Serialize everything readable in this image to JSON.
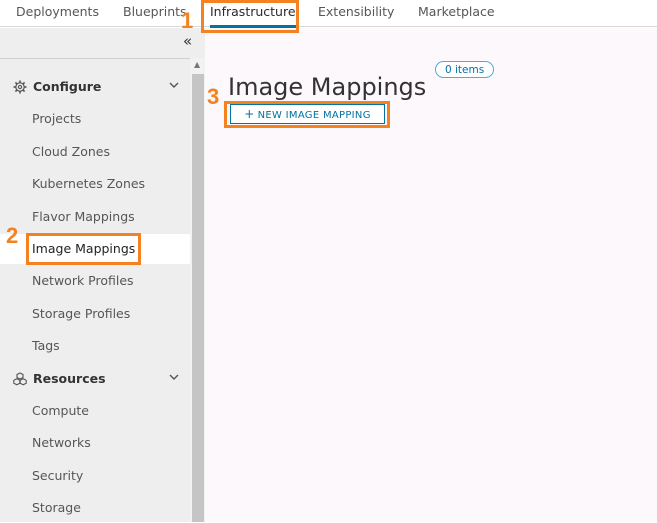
{
  "topnav": {
    "tabs": [
      {
        "label": "Deployments"
      },
      {
        "label": "Blueprints"
      },
      {
        "label": "Infrastructure"
      },
      {
        "label": "Extensibility"
      },
      {
        "label": "Marketplace"
      }
    ],
    "active_tab": "Infrastructure"
  },
  "sidebar": {
    "collapse_icon": "double-chevron-left-icon",
    "groups": [
      {
        "label": "Configure",
        "icon": "gear-icon",
        "expanded": true,
        "items": [
          {
            "label": "Projects"
          },
          {
            "label": "Cloud Zones"
          },
          {
            "label": "Kubernetes Zones"
          },
          {
            "label": "Flavor Mappings"
          },
          {
            "label": "Image Mappings"
          },
          {
            "label": "Network Profiles"
          },
          {
            "label": "Storage Profiles"
          },
          {
            "label": "Tags"
          }
        ]
      },
      {
        "label": "Resources",
        "icon": "cubes-icon",
        "expanded": true,
        "items": [
          {
            "label": "Compute"
          },
          {
            "label": "Networks"
          },
          {
            "label": "Security"
          },
          {
            "label": "Storage"
          }
        ]
      }
    ],
    "active_item": "Image Mappings"
  },
  "main": {
    "title": "Image Mappings",
    "count_badge": "0 items",
    "new_button_label": "NEW IMAGE MAPPING",
    "new_button_icon": "plus-icon"
  },
  "annotations": {
    "color": "#f58220",
    "steps": [
      "1",
      "2",
      "3"
    ]
  }
}
